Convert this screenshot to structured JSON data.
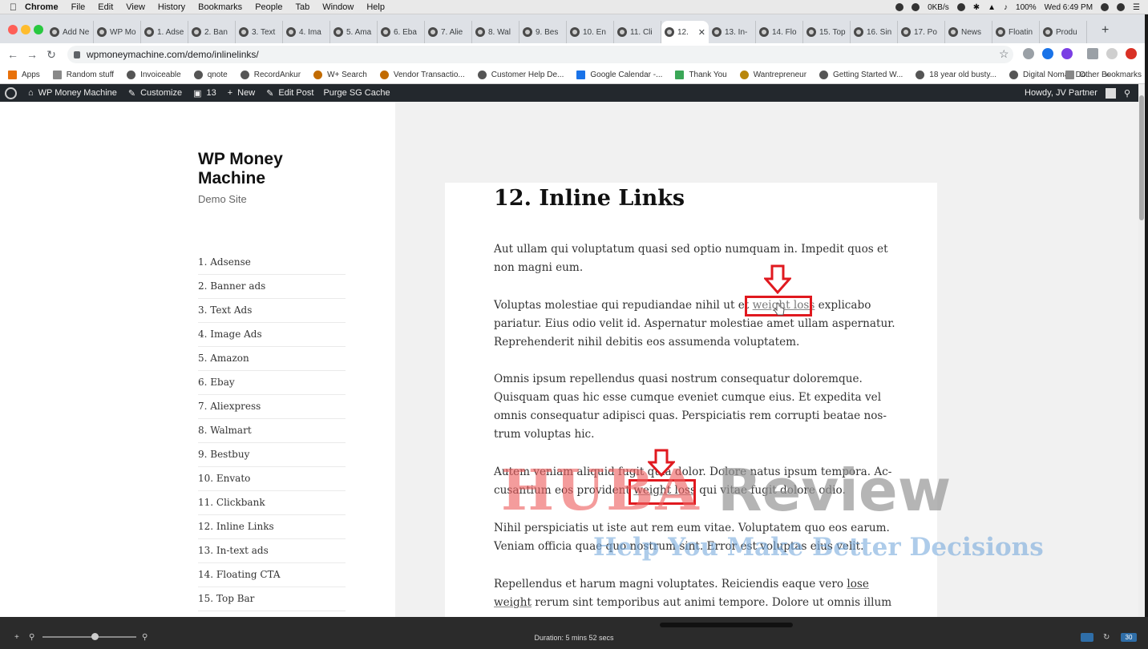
{
  "mac_menubar": {
    "items": [
      "Chrome",
      "File",
      "Edit",
      "View",
      "History",
      "Bookmarks",
      "People",
      "Tab",
      "Window",
      "Help"
    ],
    "net_speed": "0KB/s",
    "battery": "100%",
    "clock": "Wed 6:49 PM"
  },
  "tabs": [
    {
      "label": "Add Ne"
    },
    {
      "label": "WP Mo"
    },
    {
      "label": "1. Adse"
    },
    {
      "label": "2. Ban"
    },
    {
      "label": "3. Text"
    },
    {
      "label": "4. Ima"
    },
    {
      "label": "5. Ama"
    },
    {
      "label": "6. Eba"
    },
    {
      "label": "7. Alie"
    },
    {
      "label": "8. Wal"
    },
    {
      "label": "9. Bes"
    },
    {
      "label": "10. En"
    },
    {
      "label": "11. Cli"
    },
    {
      "label": "12."
    },
    {
      "label": "13. In-"
    },
    {
      "label": "14. Flo"
    },
    {
      "label": "15. Top"
    },
    {
      "label": "16. Sin"
    },
    {
      "label": "17. Po"
    },
    {
      "label": "News"
    },
    {
      "label": "Floatin"
    },
    {
      "label": "Produ"
    }
  ],
  "address_bar": {
    "url": "wpmoneymachine.com/demo/inlinelinks/"
  },
  "bookmarks": [
    "Apps",
    "Random stuff",
    "Invoiceable",
    "qnote",
    "RecordAnkur",
    "W+ Search",
    "Vendor Transactio...",
    "Customer Help De...",
    "Google Calendar -...",
    "Thank You",
    "Wantrepreneur",
    "Getting Started W...",
    "18 year old busty...",
    "Digital Nomad Do...",
    "»"
  ],
  "bookmarks_other": "Other Bookmarks",
  "wp_admin_bar": {
    "site": "WP Money Machine",
    "customize": "Customize",
    "comments": "13",
    "new": "New",
    "edit": "Edit Post",
    "purge": "Purge SG Cache",
    "howdy": "Howdy, JV Partner"
  },
  "site": {
    "title": "WP Money Machine",
    "tagline": "Demo Site"
  },
  "menu": [
    "1. Adsense",
    "2. Banner ads",
    "3. Text Ads",
    "4. Image Ads",
    "5. Amazon",
    "6. Ebay",
    "7. Aliexpress",
    "8. Walmart",
    "9. Bestbuy",
    "10. Envato",
    "11. Clickbank",
    "12. Inline Links",
    "13. In-text ads",
    "14. Floating CTA",
    "15. Top Bar"
  ],
  "post": {
    "title": "12. Inline Links",
    "p1": [
      "Aut ullam qui voluptatum quasi sed optio numquam in. Impedit quos et",
      "non magni eum."
    ],
    "p2_l1_pre": "Voluptas molestiae qui repudiandae nihil ut et ",
    "p2_l1_link": "weight loss",
    "p2_l1_post": " explicabo",
    "p2_rest": [
      "pariatur. Eius odio velit id. Aspernatur molestiae amet ullam aspernatur.",
      "Reprehenderit nihil debitis eos assumenda voluptatem."
    ],
    "p3": [
      "Omnis ipsum repellendus quasi nostrum consequatur doloremque.",
      "Quisquam quas hic esse cumque eveniet cumque eius. Et expedita vel",
      "omnis consequatur adipisci quas. Perspiciatis rem corrupti beatae nos-",
      "trum voluptas hic."
    ],
    "p4_l1": "Autem veniam aliquid fugit quia dolor. Dolore natus ipsum tempora. Ac-",
    "p4_l2_pre": "cusantium eos provident ",
    "p4_l2_link": "weight loss",
    "p4_l2_post": " qui vitae fugit dolore odio.",
    "p5": [
      "Nihil perspiciatis ut iste aut rem eum vitae. Voluptatem quo eos earum.",
      "Veniam officia quae quo nostrum sint. Error est voluptas eius velit."
    ],
    "p6_l1_pre": "Repellendus et harum magni voluptates. Reiciendis eaque vero ",
    "p6_l1_link": "lose",
    "p6_l2_link": "weight",
    "p6_l2_post": " rerum sint temporibus aut animi tempore. Dolore ut omnis illum"
  },
  "watermark": {
    "brand_a": "HUBA",
    "brand_b": "Review",
    "slogan": "Help You Make Better Decisions"
  },
  "player": {
    "duration": "Duration: 5 mins 52 secs",
    "speed_badge": "30"
  },
  "colors": {
    "highlight_red": "#e0191f",
    "wp_bar": "#23282d"
  }
}
